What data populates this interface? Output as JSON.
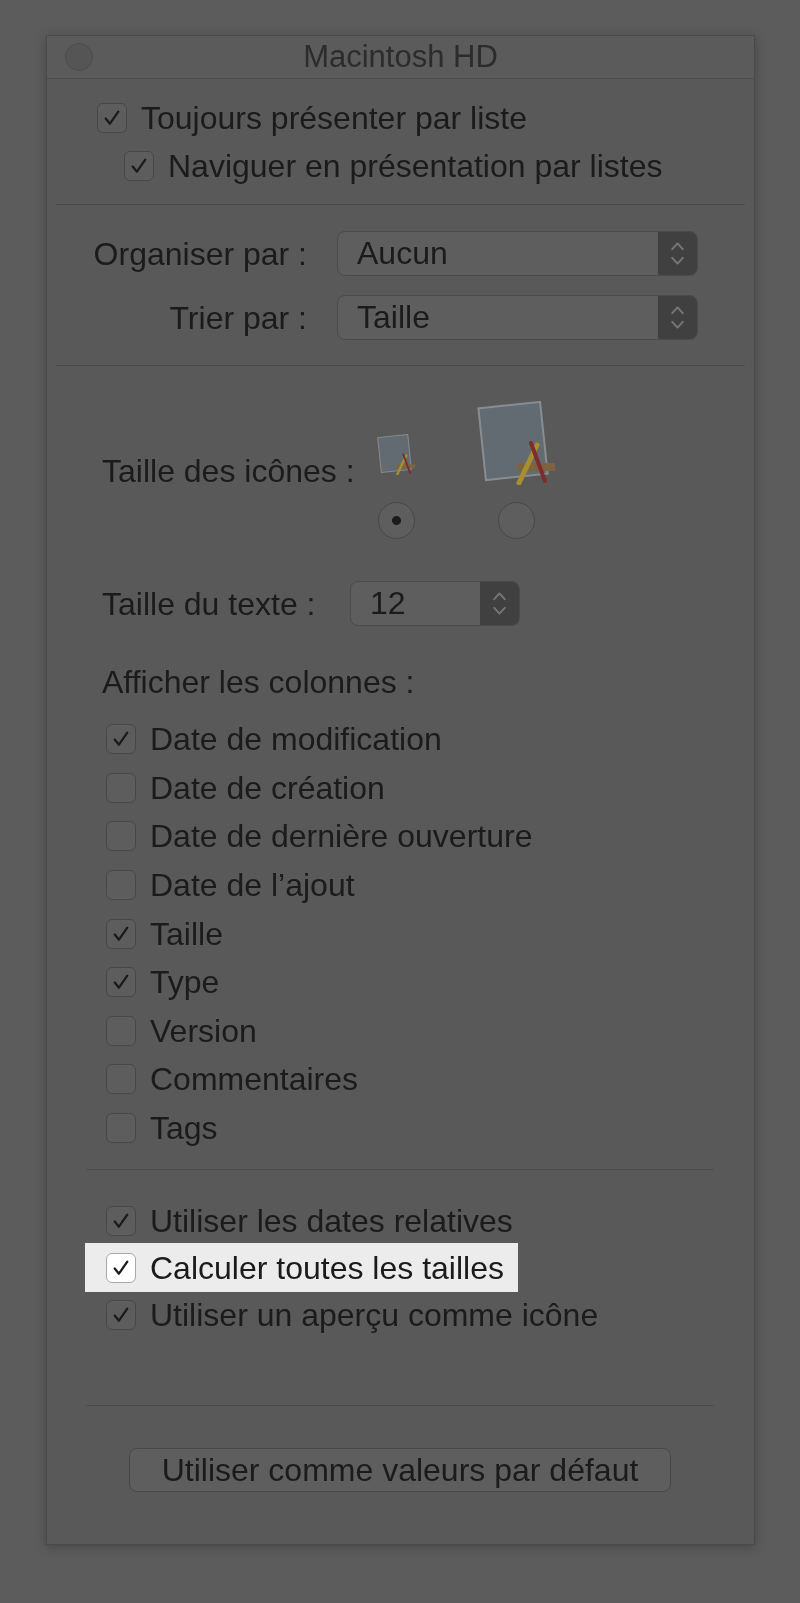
{
  "window": {
    "title": "Macintosh HD"
  },
  "view": [
    {
      "label": "Toujours présenter par liste",
      "checked": true,
      "children": [
        {
          "label": "Naviguer en présentation par listes",
          "checked": true
        }
      ]
    }
  ],
  "arrange": {
    "label": "Organiser par :",
    "value": "Aucun"
  },
  "sort": {
    "label": "Trier par :",
    "value": "Taille"
  },
  "icon_size": {
    "label": "Taille des icônes :",
    "options": [
      {
        "kind": "small",
        "selected": true
      },
      {
        "kind": "large",
        "selected": false
      }
    ]
  },
  "text_size": {
    "label": "Taille du texte :",
    "value": "12"
  },
  "columns": {
    "label": "Afficher les colonnes :",
    "items": [
      {
        "label": "Date de modification",
        "checked": true
      },
      {
        "label": "Date de création",
        "checked": false
      },
      {
        "label": "Date de dernière ouverture",
        "checked": false
      },
      {
        "label": "Date de l’ajout",
        "checked": false
      },
      {
        "label": "Taille",
        "checked": true
      },
      {
        "label": "Type",
        "checked": true
      },
      {
        "label": "Version",
        "checked": false
      },
      {
        "label": "Commentaires",
        "checked": false
      },
      {
        "label": "Tags",
        "checked": false
      }
    ]
  },
  "options": [
    {
      "label": "Utiliser les dates relatives",
      "checked": true,
      "highlighted": false
    },
    {
      "label": "Calculer toutes les tailles",
      "checked": true,
      "highlighted": true
    },
    {
      "label": "Utiliser un aperçu comme icône",
      "checked": true,
      "highlighted": false
    }
  ],
  "default_button": {
    "label": "Utiliser comme valeurs par défaut"
  }
}
